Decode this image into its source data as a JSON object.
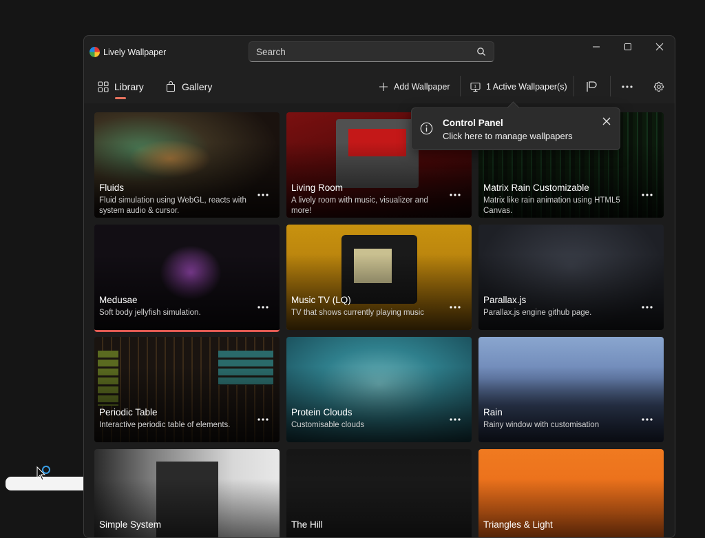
{
  "app": {
    "title": "Lively Wallpaper"
  },
  "search": {
    "placeholder": "Search",
    "value": ""
  },
  "nav": {
    "library": "Library",
    "gallery": "Gallery"
  },
  "toolbar": {
    "add_wallpaper": "Add Wallpaper",
    "active_wallpapers": "1 Active Wallpaper(s)"
  },
  "colors": {
    "accent": "#e8735e",
    "selected": "#e05a52",
    "background": "#202020"
  },
  "teaching_tip": {
    "title": "Control Panel",
    "subtitle": "Click here to manage wallpapers"
  },
  "wallpapers": [
    {
      "title": "Fluids",
      "description": "Fluid simulation using WebGL, reacts with system audio & cursor.",
      "selected": false
    },
    {
      "title": "Living Room",
      "description": "A lively room with music, visualizer and more!",
      "selected": false
    },
    {
      "title": "Matrix Rain Customizable",
      "description": "Matrix like rain animation using HTML5 Canvas.",
      "selected": false
    },
    {
      "title": "Medusae",
      "description": "Soft body jellyfish simulation.",
      "selected": true
    },
    {
      "title": "Music TV (LQ)",
      "description": "TV that shows currently playing music",
      "selected": false
    },
    {
      "title": "Parallax.js",
      "description": "Parallax.js engine github page.",
      "selected": false
    },
    {
      "title": "Periodic Table",
      "description": "Interactive periodic table of elements.",
      "selected": false
    },
    {
      "title": "Protein Clouds",
      "description": "Customisable clouds",
      "selected": false
    },
    {
      "title": "Rain",
      "description": "Rainy window with customisation",
      "selected": false
    },
    {
      "title": "Simple System",
      "description": "",
      "selected": false
    },
    {
      "title": "The Hill",
      "description": "",
      "selected": false
    },
    {
      "title": "Triangles & Light",
      "description": "",
      "selected": false
    }
  ],
  "icons": {
    "library": "grid-icon",
    "gallery": "shopping-bag-icon",
    "add": "plus-icon",
    "monitor": "monitor-icon",
    "flag": "flag-icon",
    "more": "ellipsis-icon",
    "settings": "gear-icon",
    "search": "search-icon",
    "info": "info-icon",
    "close": "close-icon"
  }
}
